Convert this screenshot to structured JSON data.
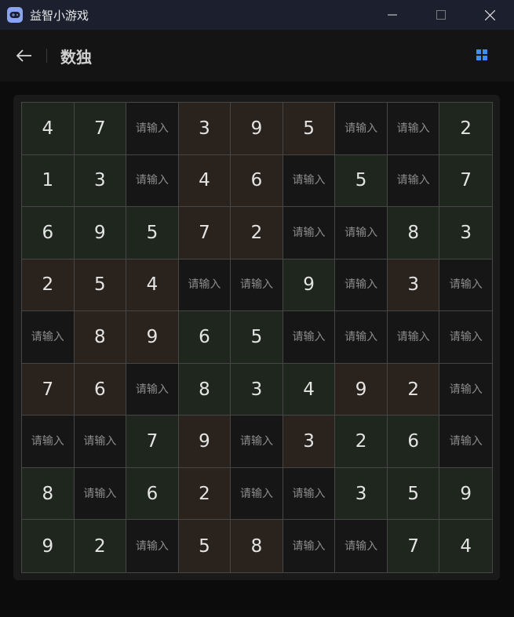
{
  "window": {
    "title": "益智小游戏",
    "minimize_icon": "minimize-icon",
    "maximize_icon": "maximize-icon",
    "close_icon": "close-icon"
  },
  "header": {
    "title": "数独",
    "back_icon": "arrow-left-icon",
    "menu_icon": "grid-icon"
  },
  "board": {
    "placeholder": "请输入",
    "rows": [
      [
        "4",
        "7",
        "",
        "3",
        "9",
        "5",
        "",
        "",
        "2"
      ],
      [
        "1",
        "3",
        "",
        "4",
        "6",
        "",
        "5",
        "",
        "7"
      ],
      [
        "6",
        "9",
        "5",
        "7",
        "2",
        "",
        "",
        "8",
        "3"
      ],
      [
        "2",
        "5",
        "4",
        "",
        "",
        "9",
        "",
        "3",
        ""
      ],
      [
        "",
        "8",
        "9",
        "6",
        "5",
        "",
        "",
        "",
        ""
      ],
      [
        "7",
        "6",
        "",
        "8",
        "3",
        "4",
        "9",
        "2",
        ""
      ],
      [
        "",
        "",
        "7",
        "9",
        "",
        "3",
        "2",
        "6",
        ""
      ],
      [
        "8",
        "",
        "6",
        "2",
        "",
        "",
        "3",
        "5",
        "9"
      ],
      [
        "9",
        "2",
        "",
        "5",
        "8",
        "",
        "",
        "7",
        "4"
      ]
    ]
  },
  "colors": {
    "block_even": "#1e261e",
    "block_odd": "#2a231d",
    "empty_cell": "#161616",
    "accent": "#3d8ef0"
  }
}
